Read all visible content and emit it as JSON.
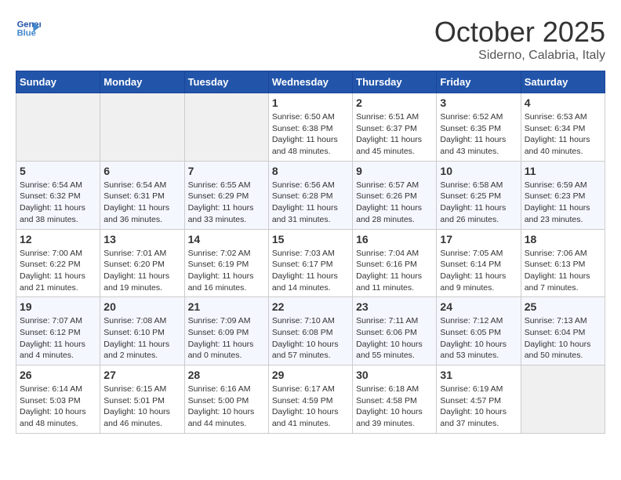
{
  "header": {
    "logo_line1": "General",
    "logo_line2": "Blue",
    "month": "October 2025",
    "location": "Siderno, Calabria, Italy"
  },
  "days_of_week": [
    "Sunday",
    "Monday",
    "Tuesday",
    "Wednesday",
    "Thursday",
    "Friday",
    "Saturday"
  ],
  "weeks": [
    [
      {
        "day": "",
        "info": ""
      },
      {
        "day": "",
        "info": ""
      },
      {
        "day": "",
        "info": ""
      },
      {
        "day": "1",
        "info": "Sunrise: 6:50 AM\nSunset: 6:38 PM\nDaylight: 11 hours\nand 48 minutes."
      },
      {
        "day": "2",
        "info": "Sunrise: 6:51 AM\nSunset: 6:37 PM\nDaylight: 11 hours\nand 45 minutes."
      },
      {
        "day": "3",
        "info": "Sunrise: 6:52 AM\nSunset: 6:35 PM\nDaylight: 11 hours\nand 43 minutes."
      },
      {
        "day": "4",
        "info": "Sunrise: 6:53 AM\nSunset: 6:34 PM\nDaylight: 11 hours\nand 40 minutes."
      }
    ],
    [
      {
        "day": "5",
        "info": "Sunrise: 6:54 AM\nSunset: 6:32 PM\nDaylight: 11 hours\nand 38 minutes."
      },
      {
        "day": "6",
        "info": "Sunrise: 6:54 AM\nSunset: 6:31 PM\nDaylight: 11 hours\nand 36 minutes."
      },
      {
        "day": "7",
        "info": "Sunrise: 6:55 AM\nSunset: 6:29 PM\nDaylight: 11 hours\nand 33 minutes."
      },
      {
        "day": "8",
        "info": "Sunrise: 6:56 AM\nSunset: 6:28 PM\nDaylight: 11 hours\nand 31 minutes."
      },
      {
        "day": "9",
        "info": "Sunrise: 6:57 AM\nSunset: 6:26 PM\nDaylight: 11 hours\nand 28 minutes."
      },
      {
        "day": "10",
        "info": "Sunrise: 6:58 AM\nSunset: 6:25 PM\nDaylight: 11 hours\nand 26 minutes."
      },
      {
        "day": "11",
        "info": "Sunrise: 6:59 AM\nSunset: 6:23 PM\nDaylight: 11 hours\nand 23 minutes."
      }
    ],
    [
      {
        "day": "12",
        "info": "Sunrise: 7:00 AM\nSunset: 6:22 PM\nDaylight: 11 hours\nand 21 minutes."
      },
      {
        "day": "13",
        "info": "Sunrise: 7:01 AM\nSunset: 6:20 PM\nDaylight: 11 hours\nand 19 minutes."
      },
      {
        "day": "14",
        "info": "Sunrise: 7:02 AM\nSunset: 6:19 PM\nDaylight: 11 hours\nand 16 minutes."
      },
      {
        "day": "15",
        "info": "Sunrise: 7:03 AM\nSunset: 6:17 PM\nDaylight: 11 hours\nand 14 minutes."
      },
      {
        "day": "16",
        "info": "Sunrise: 7:04 AM\nSunset: 6:16 PM\nDaylight: 11 hours\nand 11 minutes."
      },
      {
        "day": "17",
        "info": "Sunrise: 7:05 AM\nSunset: 6:14 PM\nDaylight: 11 hours\nand 9 minutes."
      },
      {
        "day": "18",
        "info": "Sunrise: 7:06 AM\nSunset: 6:13 PM\nDaylight: 11 hours\nand 7 minutes."
      }
    ],
    [
      {
        "day": "19",
        "info": "Sunrise: 7:07 AM\nSunset: 6:12 PM\nDaylight: 11 hours\nand 4 minutes."
      },
      {
        "day": "20",
        "info": "Sunrise: 7:08 AM\nSunset: 6:10 PM\nDaylight: 11 hours\nand 2 minutes."
      },
      {
        "day": "21",
        "info": "Sunrise: 7:09 AM\nSunset: 6:09 PM\nDaylight: 11 hours\nand 0 minutes."
      },
      {
        "day": "22",
        "info": "Sunrise: 7:10 AM\nSunset: 6:08 PM\nDaylight: 10 hours\nand 57 minutes."
      },
      {
        "day": "23",
        "info": "Sunrise: 7:11 AM\nSunset: 6:06 PM\nDaylight: 10 hours\nand 55 minutes."
      },
      {
        "day": "24",
        "info": "Sunrise: 7:12 AM\nSunset: 6:05 PM\nDaylight: 10 hours\nand 53 minutes."
      },
      {
        "day": "25",
        "info": "Sunrise: 7:13 AM\nSunset: 6:04 PM\nDaylight: 10 hours\nand 50 minutes."
      }
    ],
    [
      {
        "day": "26",
        "info": "Sunrise: 6:14 AM\nSunset: 5:03 PM\nDaylight: 10 hours\nand 48 minutes."
      },
      {
        "day": "27",
        "info": "Sunrise: 6:15 AM\nSunset: 5:01 PM\nDaylight: 10 hours\nand 46 minutes."
      },
      {
        "day": "28",
        "info": "Sunrise: 6:16 AM\nSunset: 5:00 PM\nDaylight: 10 hours\nand 44 minutes."
      },
      {
        "day": "29",
        "info": "Sunrise: 6:17 AM\nSunset: 4:59 PM\nDaylight: 10 hours\nand 41 minutes."
      },
      {
        "day": "30",
        "info": "Sunrise: 6:18 AM\nSunset: 4:58 PM\nDaylight: 10 hours\nand 39 minutes."
      },
      {
        "day": "31",
        "info": "Sunrise: 6:19 AM\nSunset: 4:57 PM\nDaylight: 10 hours\nand 37 minutes."
      },
      {
        "day": "",
        "info": ""
      }
    ]
  ]
}
